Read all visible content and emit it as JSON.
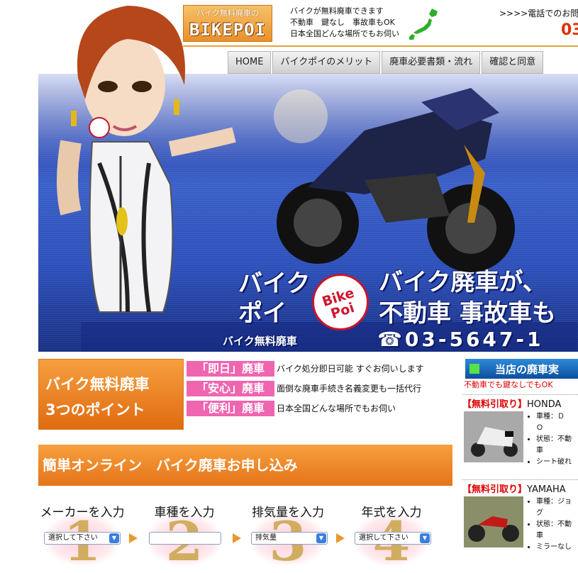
{
  "header": {
    "logo_sub": "バイク無料廃車の",
    "logo_main": "BIKEPOI",
    "tagline": [
      "バイクが無料廃車できます",
      "不動車　鍵なし　事故車もOK",
      "日本全国どんな場所でもお伺い"
    ],
    "phone_lead": ">>>>電話でのお問",
    "phone_number": "03"
  },
  "nav": {
    "items": [
      "HOME",
      "バイクポイのメリット",
      "廃車必要書類・流れ",
      "確認と同意"
    ]
  },
  "hero": {
    "left_text_1": "バイク",
    "left_text_2": "ポイ",
    "badge": "Bike Poi",
    "headline_1": "バイク廃車が、",
    "headline_2": "不動車 事故車も",
    "subcaption": "バイク無料廃車",
    "phone": "☎03-5647-1"
  },
  "points": {
    "box_line1": "バイク無料廃車",
    "box_line2": "3つのポイント",
    "items": [
      {
        "tag": "「即日」廃車",
        "desc": "バイク処分即日可能 すぐお伺いします"
      },
      {
        "tag": "「安心」廃車",
        "desc": "面倒な廃車手続き名義変更も一括代行"
      },
      {
        "tag": "「便利」廃車",
        "desc": "日本全国どんな場所でもお伺い"
      }
    ]
  },
  "form": {
    "title": "簡単オンライン　バイク廃車お申し込み",
    "steps": [
      {
        "num": "1",
        "label": "メーカーを入力",
        "control": "選択して下さい"
      },
      {
        "num": "2",
        "label": "車種を入力",
        "control": ""
      },
      {
        "num": "3",
        "label": "排気量を入力",
        "control": "排気量"
      },
      {
        "num": "4",
        "label": "年式を入力",
        "control": "選択して下さい"
      }
    ]
  },
  "right_col": {
    "title": "当店の廃車実",
    "subtitle": "不動車でも鍵なしでもOK",
    "items": [
      {
        "tag": "【無料引取り】",
        "name": "HONDA",
        "specs": [
          "車種：Ｄ",
          "Ｏ",
          "状態：不動",
          "車",
          "シート破れ"
        ]
      },
      {
        "tag": "【無料引取り】",
        "name": "YAMAHA",
        "specs": [
          "車種：ジョ",
          "グ",
          "状態：不動",
          "車",
          "ミラーなし"
        ]
      }
    ]
  },
  "colors": {
    "accent_orange": "#e9892a",
    "pink": "#f065b0",
    "hero_blue": "#2c4fb9",
    "red": "#e00000"
  }
}
